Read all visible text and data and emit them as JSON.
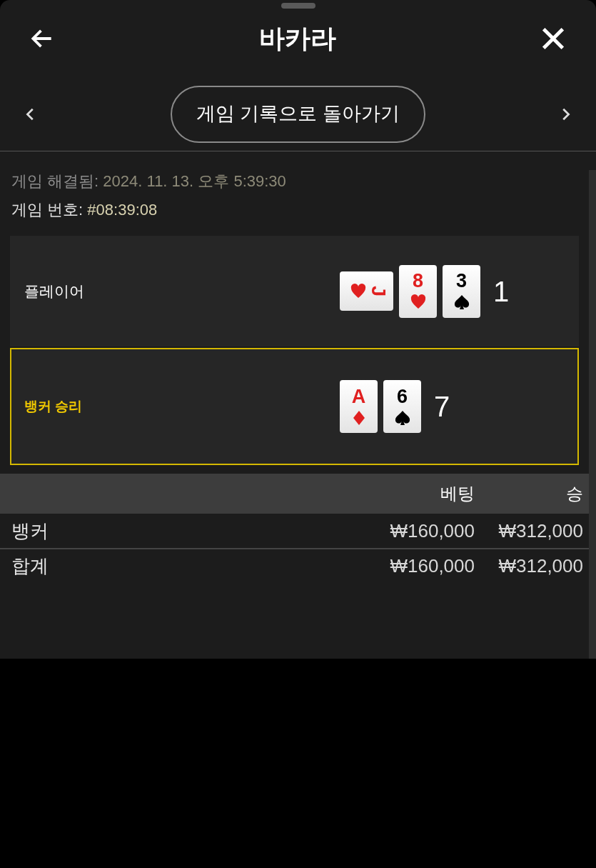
{
  "header": {
    "title": "바카라"
  },
  "nav": {
    "back_button": "게임 기록으로 돌아가기"
  },
  "info": [
    {
      "label": "게임 해결됨:",
      "value": "2024. 11. 13. 오후 5:39:30",
      "kind": "muted"
    },
    {
      "label": "게임 번호:",
      "value": "#08:39:08",
      "kind": "plain"
    }
  ],
  "hands": [
    {
      "label": "플레이어",
      "winner": false,
      "total": "1",
      "cards": [
        {
          "rank": "J",
          "kind": "hearts",
          "sideways": true
        },
        {
          "rank": "8",
          "kind": "hearts",
          "sideways": false
        },
        {
          "rank": "3",
          "kind": "spades",
          "sideways": false
        }
      ]
    },
    {
      "label": "뱅커 승리",
      "winner": true,
      "total": "7",
      "cards": [
        {
          "rank": "A",
          "kind": "diamonds",
          "sideways": false
        },
        {
          "rank": "6",
          "kind": "spades",
          "sideways": false
        }
      ]
    }
  ],
  "table": {
    "columns": [
      "베팅",
      "승"
    ],
    "rows": [
      {
        "name": "뱅커",
        "bet": "₩160,000",
        "win": "₩312,000"
      },
      {
        "name": "합계",
        "bet": "₩160,000",
        "win": "₩312,000"
      }
    ]
  }
}
